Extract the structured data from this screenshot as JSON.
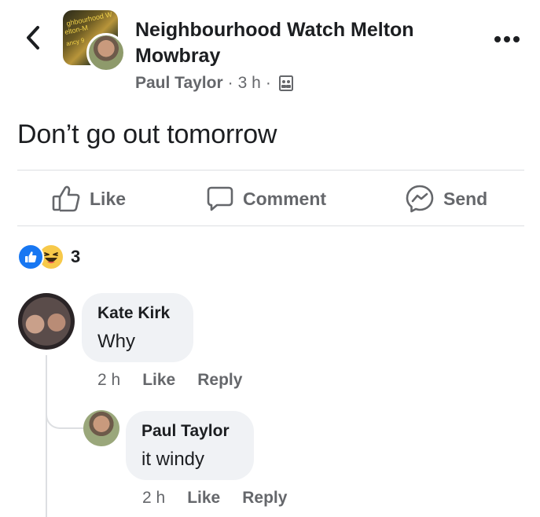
{
  "header": {
    "group_name": "Neighbourhood Watch Melton Mowbray",
    "group_avatar_text": [
      "ghbourhood W",
      "elton-M",
      "ancy 9"
    ],
    "author": "Paul Taylor",
    "time": "3 h",
    "separator": "·",
    "icons": {
      "back": "chevron-left-icon",
      "more": "more-horizontal-icon",
      "privacy": "group-privacy-icon"
    }
  },
  "post": {
    "text": "Don’t go out tomorrow"
  },
  "actions": {
    "like": "Like",
    "comment": "Comment",
    "send": "Send"
  },
  "reactions": {
    "count": "3",
    "types": [
      "like-icon",
      "haha-icon"
    ],
    "colors": {
      "like": "#1877f2",
      "haha": "#f7c94a"
    }
  },
  "comments": [
    {
      "name": "Kate Kirk",
      "text": "Why",
      "time": "2 h",
      "like": "Like",
      "reply": "Reply"
    },
    {
      "name": "Paul Taylor",
      "text": "it windy",
      "time": "2 h",
      "like": "Like",
      "reply": "Reply"
    }
  ],
  "colors": {
    "text": "#1c1e21",
    "secondary": "#65676b",
    "bubble": "#f0f2f5",
    "divider": "#dddfe2"
  }
}
